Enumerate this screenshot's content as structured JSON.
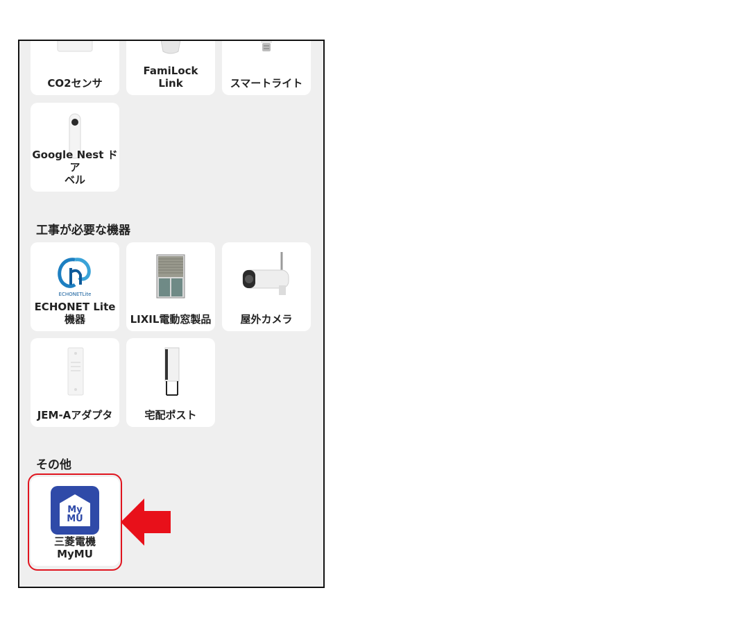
{
  "devices_top": [
    {
      "label": "CO2センサ",
      "icon": "co2-sensor-icon"
    },
    {
      "label": "FamiLock\nLink",
      "icon": "familock-link-icon"
    },
    {
      "label": "スマートライト",
      "icon": "smart-light-bulb-icon"
    },
    {
      "label": "Google Nest ドア\nベル",
      "icon": "google-nest-doorbell-icon"
    }
  ],
  "sections": {
    "construction_title": "工事が必要な機器",
    "other_title": "その他"
  },
  "devices_construction": [
    {
      "label": "ECHONET Lite\n機器",
      "icon": "echonet-lite-logo"
    },
    {
      "label": "LIXIL電動窓製品",
      "icon": "lixil-shutter-window-icon"
    },
    {
      "label": "屋外カメラ",
      "icon": "outdoor-camera-icon"
    },
    {
      "label": "JEM-Aアダプタ",
      "icon": "jem-a-adapter-icon"
    },
    {
      "label": "宅配ポスト",
      "icon": "delivery-box-icon"
    }
  ],
  "devices_other": [
    {
      "label": "三菱電機\nMyMU",
      "icon": "mymu-app-icon",
      "icon_text": "My\nMU"
    }
  ],
  "colors": {
    "highlight": "#e0141e",
    "arrow": "#e8101a",
    "mymu_blue": "#2f4aa8"
  },
  "echonet_caption": "ECHONETLite"
}
